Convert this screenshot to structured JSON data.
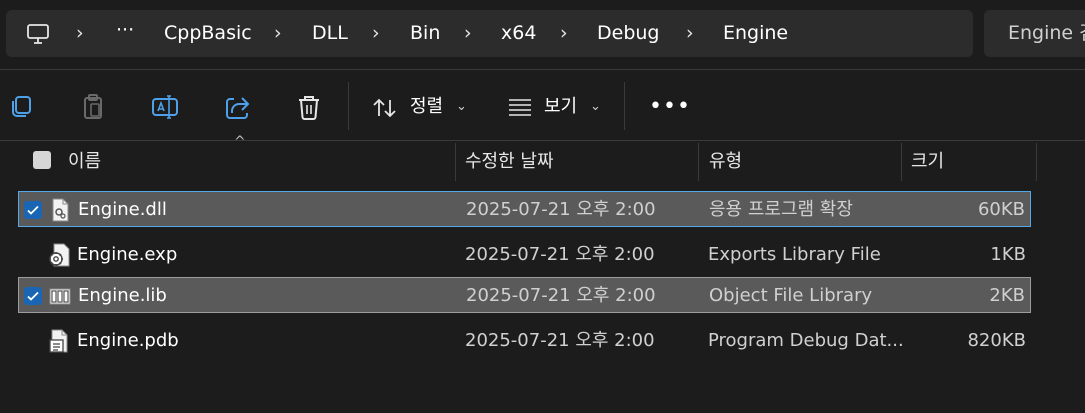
{
  "breadcrumb": [
    "CppBasic",
    "DLL",
    "Bin",
    "x64",
    "Debug",
    "Engine"
  ],
  "search": {
    "text": "Engine 검"
  },
  "toolbar": {
    "sort_label": "정렬",
    "view_label": "보기"
  },
  "columns": {
    "name": "이름",
    "modified": "수정한 날짜",
    "type": "유형",
    "size": "크기"
  },
  "files": [
    {
      "name": "Engine.dll",
      "modified": "2025-07-21 오후 2:00",
      "type": "응용 프로그램 확장",
      "size": "60KB",
      "selected": true,
      "icon": "dll-file-icon"
    },
    {
      "name": "Engine.exp",
      "modified": "2025-07-21 오후 2:00",
      "type": "Exports Library File",
      "size": "1KB",
      "selected": false,
      "icon": "exp-file-icon"
    },
    {
      "name": "Engine.lib",
      "modified": "2025-07-21 오후 2:00",
      "type": "Object File Library",
      "size": "2KB",
      "selected": true,
      "icon": "lib-file-icon"
    },
    {
      "name": "Engine.pdb",
      "modified": "2025-07-21 오후 2:00",
      "type": "Program Debug Dat...",
      "size": "820KB",
      "selected": false,
      "icon": "pdb-file-icon"
    }
  ],
  "colors": {
    "background": "#1c1c1c",
    "selection": "#5a5a5a",
    "focus_border": "#53a9e8",
    "checkbox": "#1a66b4"
  }
}
